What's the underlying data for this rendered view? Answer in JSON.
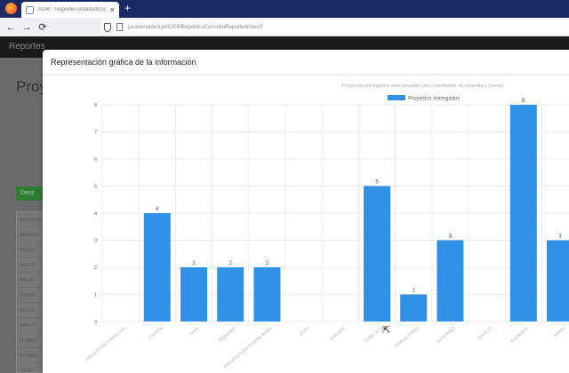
{
  "browser": {
    "tab_title": "SGM - Reportes estadísticos d...",
    "tab_close": "×",
    "new_tab": "+",
    "back": "←",
    "forward": "→",
    "reload": "⟳",
    "url": "javaserialdesign/CIP6/Reportes/ConsultaReporte/Index/2"
  },
  "app": {
    "brand": "Reportes",
    "page_title": "Proy",
    "download_button": "Desc",
    "rows": [
      "BASCONES",
      "HERRAD",
      "HOFOS",
      "BASCO",
      "PALLA",
      "DURAN",
      "VILLAR",
      "ARAUJO",
      "FLORES",
      "FLORES",
      "LOPEZ"
    ]
  },
  "modal": {
    "title": "Representación gráfica de la información"
  },
  "colors": {
    "bar": "#2f92e6",
    "grid": "#e6e6e6",
    "axis_text": "#666666"
  },
  "chart_data": {
    "type": "bar",
    "title": "Proyectos entregados seleccionados por coordinador de consulta y cuenta",
    "legend": [
      "Proyectos entregados"
    ],
    "legend_position": "top",
    "ylim": [
      0,
      8
    ],
    "yticks": [
      0,
      1,
      2,
      3,
      4,
      5,
      6,
      7,
      8
    ],
    "grid": true,
    "categories": [
      "CIRCUITO DE CONSULTAS",
      "CAMPOS",
      "GAVA",
      "DESIGNER",
      "ARQUITECTURA (DISEÑO BASE)",
      "DIVIS",
      "EUROPAT",
      "COND. CLS",
      "CONSULTORES",
      "GUTIERREZ",
      "MAVILLO",
      "ELEMENTO",
      "PARRA"
    ],
    "values": [
      0,
      4,
      2,
      2,
      2,
      0,
      0,
      5,
      1,
      3,
      0,
      8,
      3
    ],
    "labels": [
      "",
      "4",
      "2",
      "2",
      "2",
      "",
      "",
      "5",
      "1",
      "3",
      "",
      "8",
      "3"
    ]
  }
}
